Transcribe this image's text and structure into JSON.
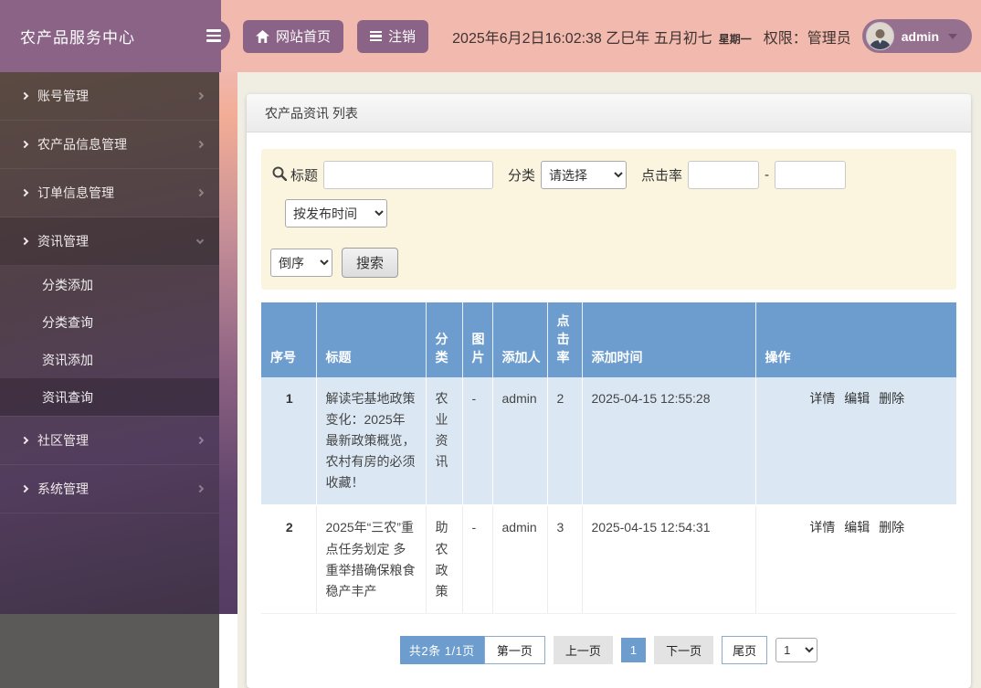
{
  "app": {
    "title": "农产品服务中心"
  },
  "header": {
    "nav_home": "网站首页",
    "nav_logout": "注销",
    "datetime": "2025年6月2日16:02:38 乙巳年 五月初七",
    "weekday": "星期一",
    "permission": "权限：管理员",
    "username": "admin"
  },
  "icons": {
    "hamburger": "menu bars",
    "home": "house",
    "logout": "list bars",
    "search": "magnifier",
    "caret_down": "triangle",
    "chevron_right": "angle right",
    "chevron_down": "angle down"
  },
  "sidebar": {
    "items": [
      {
        "label": "账号管理"
      },
      {
        "label": "农产品信息管理"
      },
      {
        "label": "订单信息管理"
      },
      {
        "label": "资讯管理",
        "expanded": true,
        "children": [
          "分类添加",
          "分类查询",
          "资讯添加",
          "资讯查询"
        ],
        "active_child": "资讯查询"
      },
      {
        "label": "社区管理"
      },
      {
        "label": "系统管理"
      }
    ]
  },
  "panel": {
    "title": "农产品资讯 列表"
  },
  "search": {
    "title_label": "标题",
    "category_label": "分类",
    "category_value": "请选择",
    "clicks_label": "点击率",
    "range_separator": "-",
    "sort_field_value": "按发布时间",
    "sort_order_value": "倒序",
    "search_button": "搜索"
  },
  "table": {
    "headers": [
      "序号",
      "标题",
      "分类",
      "图片",
      "添加人",
      "点击率",
      "添加时间",
      "操作"
    ],
    "action_labels": [
      "详情",
      "编辑",
      "删除"
    ],
    "rows": [
      {
        "seq": "1",
        "title": "解读宅基地政策变化：2025年最新政策概览，农村有房的必须收藏！",
        "category": "农业资讯",
        "image": "-",
        "added_by": "admin",
        "clicks": "2",
        "added_time": "2025-04-15 12:55:28"
      },
      {
        "seq": "2",
        "title": "2025年“三农”重点任务划定 多重举措确保粮食稳产丰产",
        "category": "助农政策",
        "image": "-",
        "added_by": "admin",
        "clicks": "3",
        "added_time": "2025-04-15 12:54:31"
      }
    ]
  },
  "pagination": {
    "summary": "共2条  1/1页",
    "first": "第一页",
    "prev": "上一页",
    "current": "1",
    "next": "下一页",
    "last": "尾页",
    "page_select": "1"
  },
  "colors": {
    "brand_purple": "#8a6386",
    "header_pink": "#f2b9ae",
    "table_header_blue": "#6d9dce",
    "row_alt_blue": "#dbe8f4",
    "search_bg": "#fbf4df",
    "main_bg": "#f0eee3"
  }
}
